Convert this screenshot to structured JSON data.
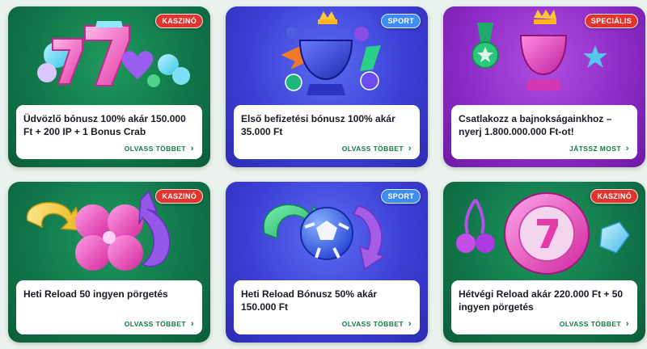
{
  "colors": {
    "badge_casino": "#e0352f",
    "badge_sport": "#3d8cf0",
    "badge_special": "#e0352f",
    "cta": "#0f7a46",
    "green_card": "#11764a",
    "blue_card": "#3c3fd6",
    "purple_card": "#8e2bc6"
  },
  "cards": [
    {
      "badge": "KASZINÓ",
      "title": "Üdvözlő bónusz 100% akár 150.000 Ft + 200 IP + 1 Bonus Crab",
      "cta": "OLVASS TÖBBET",
      "icon": "chevron-right-icon",
      "art": "slot-sevens-icon"
    },
    {
      "badge": "SPORT",
      "title": "Első befizetési bónusz 100% akár 35.000 Ft",
      "cta": "OLVASS TÖBBET",
      "icon": "chevron-right-icon",
      "art": "trophy-icon"
    },
    {
      "badge": "SPECIÁLIS",
      "title": "Csatlakozz a bajnokságainkhoz – nyerj 1.800.000.000 Ft-ot!",
      "cta": "JÁTSSZ MOST",
      "icon": "chevron-right-icon",
      "art": "medal-trophy-icon"
    },
    {
      "badge": "KASZINÓ",
      "title": "Heti Reload 50 ingyen pörgetés",
      "cta": "OLVASS TÖBBET",
      "icon": "chevron-right-icon",
      "art": "clover-arrows-icon"
    },
    {
      "badge": "SPORT",
      "title": "Heti Reload Bónusz 50% akár 150.000 Ft",
      "cta": "OLVASS TÖBBET",
      "icon": "chevron-right-icon",
      "art": "football-arrows-icon"
    },
    {
      "badge": "KASZINÓ",
      "title": "Hétvégi Reload akár 220.000 Ft + 50 ingyen pörgetés",
      "cta": "OLVASS TÖBBET",
      "icon": "chevron-right-icon",
      "art": "slot-reel-cherries-icon"
    }
  ]
}
